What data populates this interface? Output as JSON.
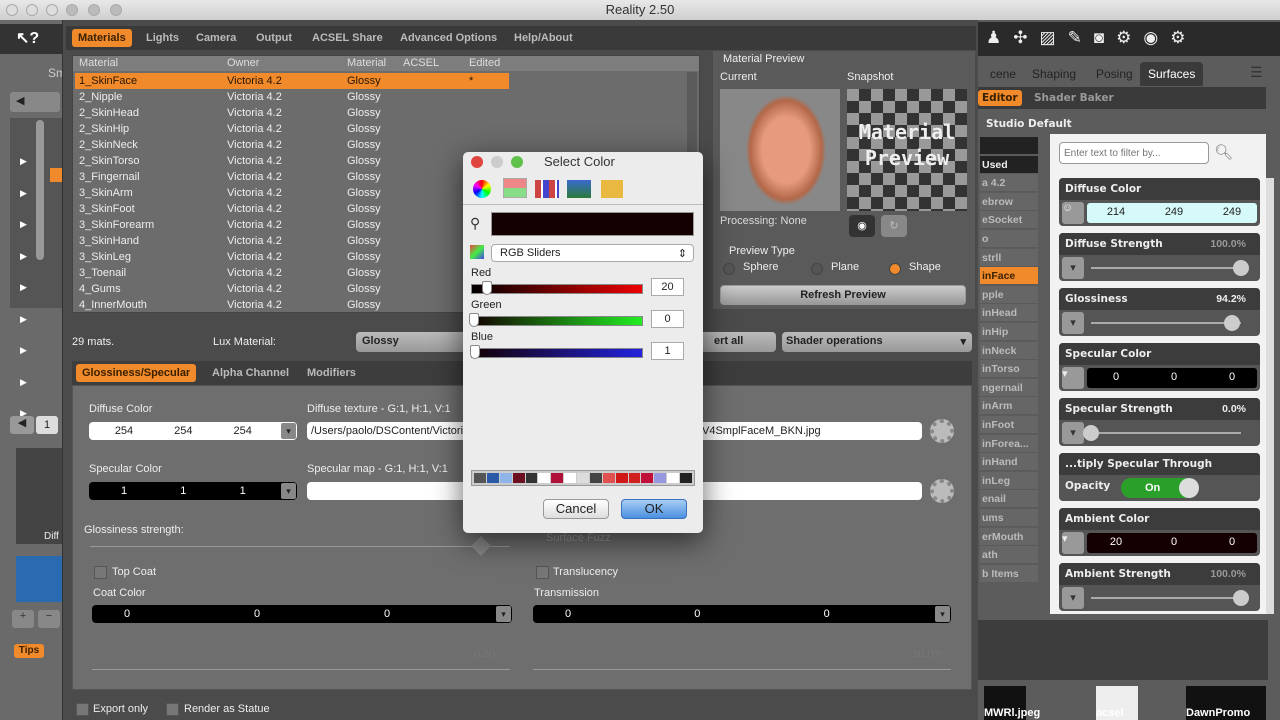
{
  "window": {
    "title": "Reality 2.50"
  },
  "tabs": [
    "Materials",
    "Lights",
    "Camera",
    "Output",
    "ACSEL Share",
    "Advanced Options",
    "Help/About"
  ],
  "table": {
    "headers": [
      "Material",
      "Owner",
      "Material",
      "ACSEL",
      "Edited"
    ],
    "rows": [
      [
        "1_SkinFace",
        "Victoria 4.2",
        "Glossy",
        "",
        "*"
      ],
      [
        "2_Nipple",
        "Victoria 4.2",
        "Glossy",
        "",
        ""
      ],
      [
        "2_SkinHead",
        "Victoria 4.2",
        "Glossy",
        "",
        ""
      ],
      [
        "2_SkinHip",
        "Victoria 4.2",
        "Glossy",
        "",
        ""
      ],
      [
        "2_SkinNeck",
        "Victoria 4.2",
        "Glossy",
        "",
        ""
      ],
      [
        "2_SkinTorso",
        "Victoria 4.2",
        "Glossy",
        "",
        ""
      ],
      [
        "3_Fingernail",
        "Victoria 4.2",
        "Glossy",
        "",
        ""
      ],
      [
        "3_SkinArm",
        "Victoria 4.2",
        "Glossy",
        "",
        ""
      ],
      [
        "3_SkinFoot",
        "Victoria 4.2",
        "Glossy",
        "",
        ""
      ],
      [
        "3_SkinForearm",
        "Victoria 4.2",
        "Glossy",
        "",
        ""
      ],
      [
        "3_SkinHand",
        "Victoria 4.2",
        "Glossy",
        "",
        ""
      ],
      [
        "3_SkinLeg",
        "Victoria 4.2",
        "Glossy",
        "",
        ""
      ],
      [
        "3_Toenail",
        "Victoria 4.2",
        "Glossy",
        "",
        ""
      ],
      [
        "4_Gums",
        "Victoria 4.2",
        "Glossy",
        "",
        ""
      ],
      [
        "4_InnerMouth",
        "Victoria 4.2",
        "Glossy",
        "",
        ""
      ]
    ]
  },
  "preview": {
    "title": "Material Preview",
    "current": "Current",
    "snapshot": "Snapshot",
    "snapshot_text": "Material Preview",
    "processing": "Processing: None",
    "type_label": "Preview Type",
    "types": [
      "Sphere",
      "Plane",
      "Shape"
    ],
    "selected_type": "Shape",
    "refresh": "Refresh Preview"
  },
  "mats_count": "29 mats.",
  "lux_label": "Lux Material:",
  "lux_value": "Glossy",
  "convert_all": "ert all",
  "shader_ops": "Shader operations",
  "subtabs": [
    "Glossiness/Specular",
    "Alpha Channel",
    "Modifiers"
  ],
  "editor": {
    "diffuse_label": "Diffuse Color",
    "diffuse": [
      "254",
      "254",
      "254"
    ],
    "diffuse_tex_label": "Diffuse texture - G:1, H:1, V:1",
    "diffuse_tex_left": "/Users/paolo/DSContent/Victori",
    "diffuse_tex_right": "V4SmplFaceM_BKN.jpg",
    "spec_label": "Specular Color",
    "spec": [
      "1",
      "1",
      "1"
    ],
    "spec_map_label": "Specular map - G:1, H:1, V:1",
    "gloss_label": "Glossiness strength:",
    "surface_fuzz": "Surface Fuzz",
    "top_coat": "Top Coat",
    "coat_color": "Coat Color",
    "coat": [
      "0",
      "0",
      "0"
    ],
    "translucency": "Translucency",
    "transmission": "Transmission",
    "trans": [
      "0",
      "0",
      "0"
    ],
    "coat_thickness_value": "0.30",
    "trans_value": "10.0%"
  },
  "bottom": {
    "export_only": "Export only",
    "render_statue": "Render as Statue"
  },
  "dialog": {
    "title": "Select Color",
    "mode": "RGB Sliders",
    "red_label": "Red",
    "red": "20",
    "green_label": "Green",
    "green": "0",
    "blue_label": "Blue",
    "blue": "1",
    "cancel": "Cancel",
    "ok": "OK",
    "swatches": [
      "#555555",
      "#2a5aa8",
      "#8fb4e8",
      "#6a1020",
      "#333333",
      "#ffffff",
      "#b0103a",
      "#ffffff",
      "#dddddd",
      "#444444",
      "#e05050",
      "#d01818",
      "#d02020",
      "#c0103a",
      "#9898e0",
      "#ffffff",
      "#222222"
    ]
  },
  "daz": {
    "left": {
      "tips": "Tips",
      "page": "1",
      "truncated_tab": "Sm",
      "diff": "Diff"
    },
    "right_tabs": [
      "cene",
      "Shaping",
      "Posing",
      "Surfaces"
    ],
    "sub_tabs": [
      "Editor",
      "Shader Baker"
    ],
    "preset": "Studio Default",
    "filter_placeholder": "Enter text to filter by...",
    "list": [
      "",
      "Used",
      "a 4.2",
      "ebrow",
      "eSocket",
      "o",
      "strll",
      "inFace",
      "pple",
      "inHead",
      "inHip",
      "inNeck",
      "inTorso",
      "ngernail",
      "inArm",
      "inFoot",
      "inForea...",
      "inHand",
      "inLeg",
      "enail",
      "ums",
      "erMouth",
      "ath",
      "b Items"
    ],
    "selected_item": "inFace",
    "props": [
      {
        "name": "Diffuse Color",
        "type": "color",
        "values": [
          "214",
          "249",
          "249"
        ],
        "color": "#d6f9f9"
      },
      {
        "name": "Diffuse Strength",
        "type": "slider",
        "value": "100.0%",
        "level": 1.0
      },
      {
        "name": "Glossiness",
        "type": "slider",
        "value": "94.2%",
        "level": 0.942
      },
      {
        "name": "Specular Color",
        "type": "color",
        "values": [
          "0",
          "0",
          "0"
        ],
        "color": "#000000"
      },
      {
        "name": "Specular Strength",
        "type": "slider",
        "value": "0.0%",
        "level": 0
      },
      {
        "name": "...tiply Specular Through Opacity",
        "type": "toggle",
        "value": "On"
      },
      {
        "name": "Ambient Color",
        "type": "color",
        "values": [
          "20",
          "0",
          "0"
        ],
        "color": "#140000"
      },
      {
        "name": "Ambient Strength",
        "type": "slider",
        "value": "100.0%",
        "level": 1.0
      }
    ],
    "thumbs": [
      "MWRl.jpeg",
      "acsel",
      "DawnPromo"
    ]
  },
  "colors": {
    "accent": "#f08a2a"
  }
}
